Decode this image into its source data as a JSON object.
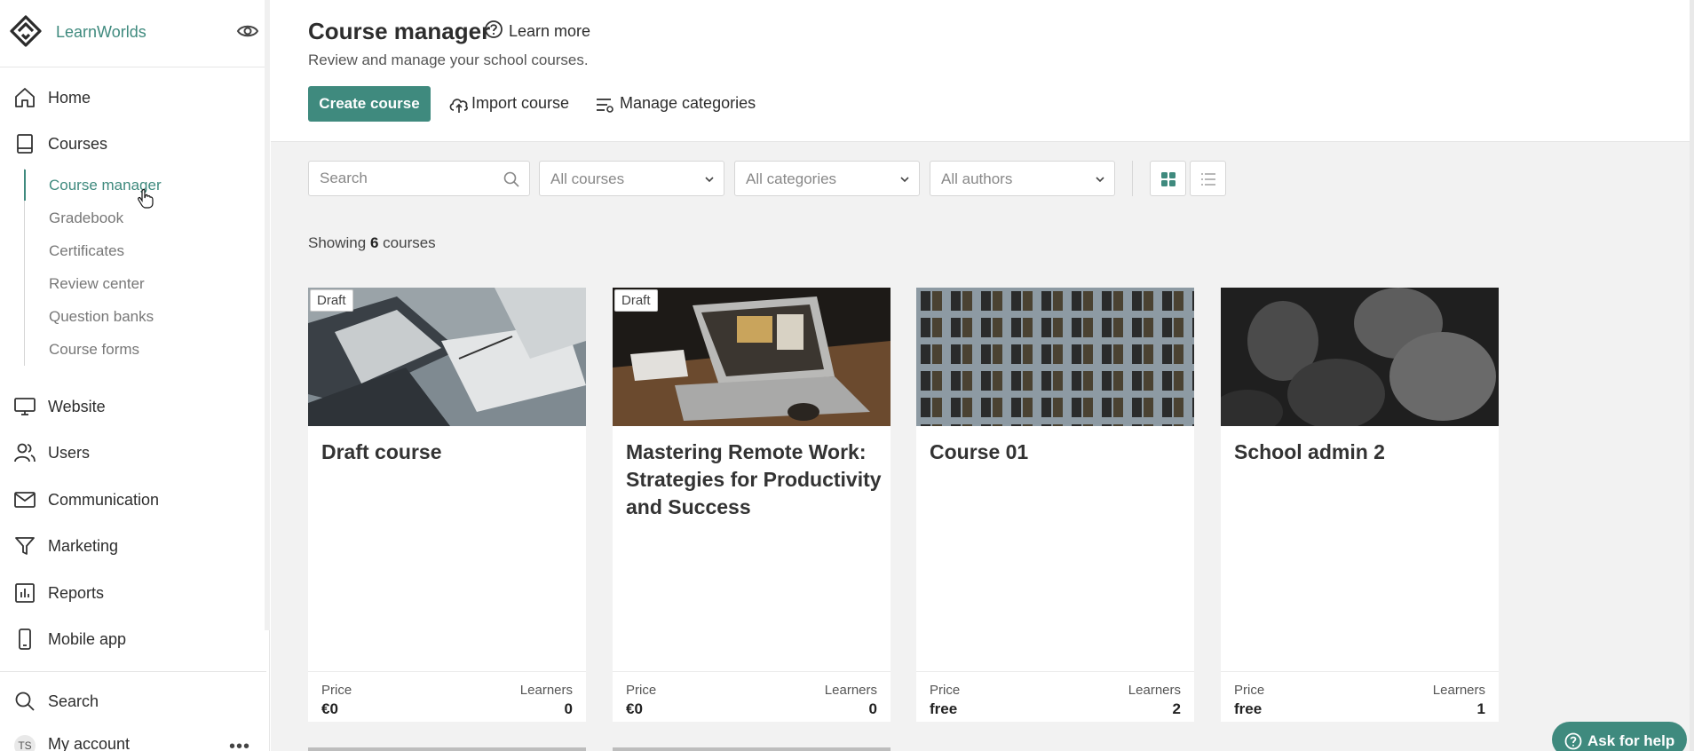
{
  "brand": {
    "name": "LearnWorlds"
  },
  "nav": {
    "home": "Home",
    "courses": "Courses",
    "sub_items": [
      "Course manager",
      "Gradebook",
      "Certificates",
      "Review center",
      "Question banks",
      "Course forms"
    ],
    "website": "Website",
    "users": "Users",
    "communication": "Communication",
    "marketing": "Marketing",
    "reports": "Reports",
    "mobile_app": "Mobile app",
    "search": "Search",
    "my_account": "My account",
    "avatar_initials": "TS"
  },
  "header": {
    "title": "Course manager",
    "learn_more": "Learn more",
    "subtitle": "Review and manage your school courses.",
    "create_course": "Create course",
    "import_course": "Import course",
    "manage_categories": "Manage categories"
  },
  "filters": {
    "search_placeholder": "Search",
    "courses": "All courses",
    "categories": "All categories",
    "authors": "All authors"
  },
  "summary": {
    "prefix": "Showing",
    "count": "6",
    "suffix": "courses"
  },
  "cards": [
    {
      "title": "Draft course",
      "badge": "Draft",
      "price_label": "Price",
      "price": "€0",
      "learners_label": "Learners",
      "learners": "0"
    },
    {
      "title": "Mastering Remote Work: Strategies for Productivity and Success",
      "badge": "Draft",
      "price_label": "Price",
      "price": "€0",
      "learners_label": "Learners",
      "learners": "0"
    },
    {
      "title": "Course 01",
      "badge": "",
      "price_label": "Price",
      "price": "free",
      "learners_label": "Learners",
      "learners": "2"
    },
    {
      "title": "School admin 2",
      "badge": "",
      "price_label": "Price",
      "price": "free",
      "learners_label": "Learners",
      "learners": "1"
    }
  ],
  "help": {
    "label": "Ask for help"
  },
  "colors": {
    "accent": "#3f8a7e",
    "background": "#f2f2f2"
  }
}
